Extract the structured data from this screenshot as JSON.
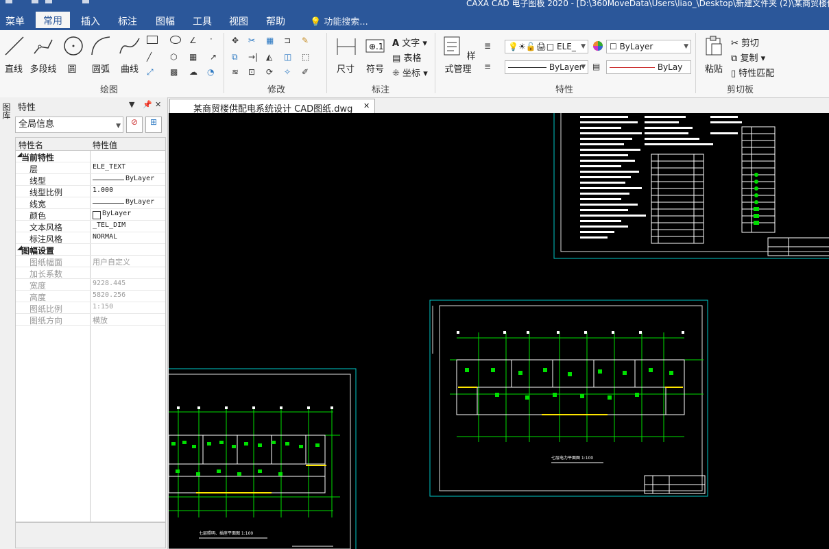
{
  "title_bar": {
    "text": "CAXA CAD 电子图板 2020 - [D:\\360MoveData\\Users\\liao_\\Desktop\\新建文件夹 (2)\\某商贸楼供配电"
  },
  "menu": {
    "items": [
      "菜单",
      "常用",
      "插入",
      "标注",
      "图幅",
      "工具",
      "视图",
      "帮助"
    ],
    "active": "常用",
    "search": "功能搜索..."
  },
  "ribbon": {
    "draw": {
      "label": "绘图",
      "buttons": [
        "直线",
        "多段线",
        "圆",
        "圆弧",
        "曲线"
      ]
    },
    "modify": {
      "label": "修改"
    },
    "dim": {
      "label": "标注",
      "buttons": [
        "尺寸",
        "符号"
      ],
      "small": [
        "文字",
        "表格",
        "坐标"
      ]
    },
    "prop": {
      "label": "特性",
      "style_btn": "样式管理",
      "layer": "ELE_",
      "color": "ByLayer",
      "linetype": "ByLayer",
      "lineweight": "ByLay"
    },
    "clip": {
      "label": "剪切板",
      "paste": "粘贴",
      "items": [
        "剪切",
        "复制",
        "特性匹配"
      ]
    }
  },
  "panel": {
    "title": "特性",
    "side_tab": "图库",
    "selector": "全局信息",
    "col_name": "特性名",
    "col_value": "特性值",
    "cat1": "当前特性",
    "rows1": [
      {
        "k": "层",
        "v": "ELE_TEXT"
      },
      {
        "k": "线型",
        "v": "ByLayer"
      },
      {
        "k": "线型比例",
        "v": "1.000"
      },
      {
        "k": "线宽",
        "v": "ByLayer"
      },
      {
        "k": "颜色",
        "v": "ByLayer"
      },
      {
        "k": "文本风格",
        "v": "_TEL_DIM"
      },
      {
        "k": "标注风格",
        "v": "NORMAL"
      }
    ],
    "cat2": "图幅设置",
    "rows2": [
      {
        "k": "图纸幅面",
        "v": "用户自定义"
      },
      {
        "k": "加长系数",
        "v": ""
      },
      {
        "k": "宽度",
        "v": "9228.445"
      },
      {
        "k": "高度",
        "v": "5820.256"
      },
      {
        "k": "图纸比例",
        "v": "1:150"
      },
      {
        "k": "图纸方向",
        "v": "横放"
      }
    ]
  },
  "document": {
    "tab": "某商贸楼供配电系统设计 CAD图纸.dwg",
    "label_right": "七层电力平面图 1:100",
    "label_left": "七层照明、插座平面图 1:100"
  }
}
